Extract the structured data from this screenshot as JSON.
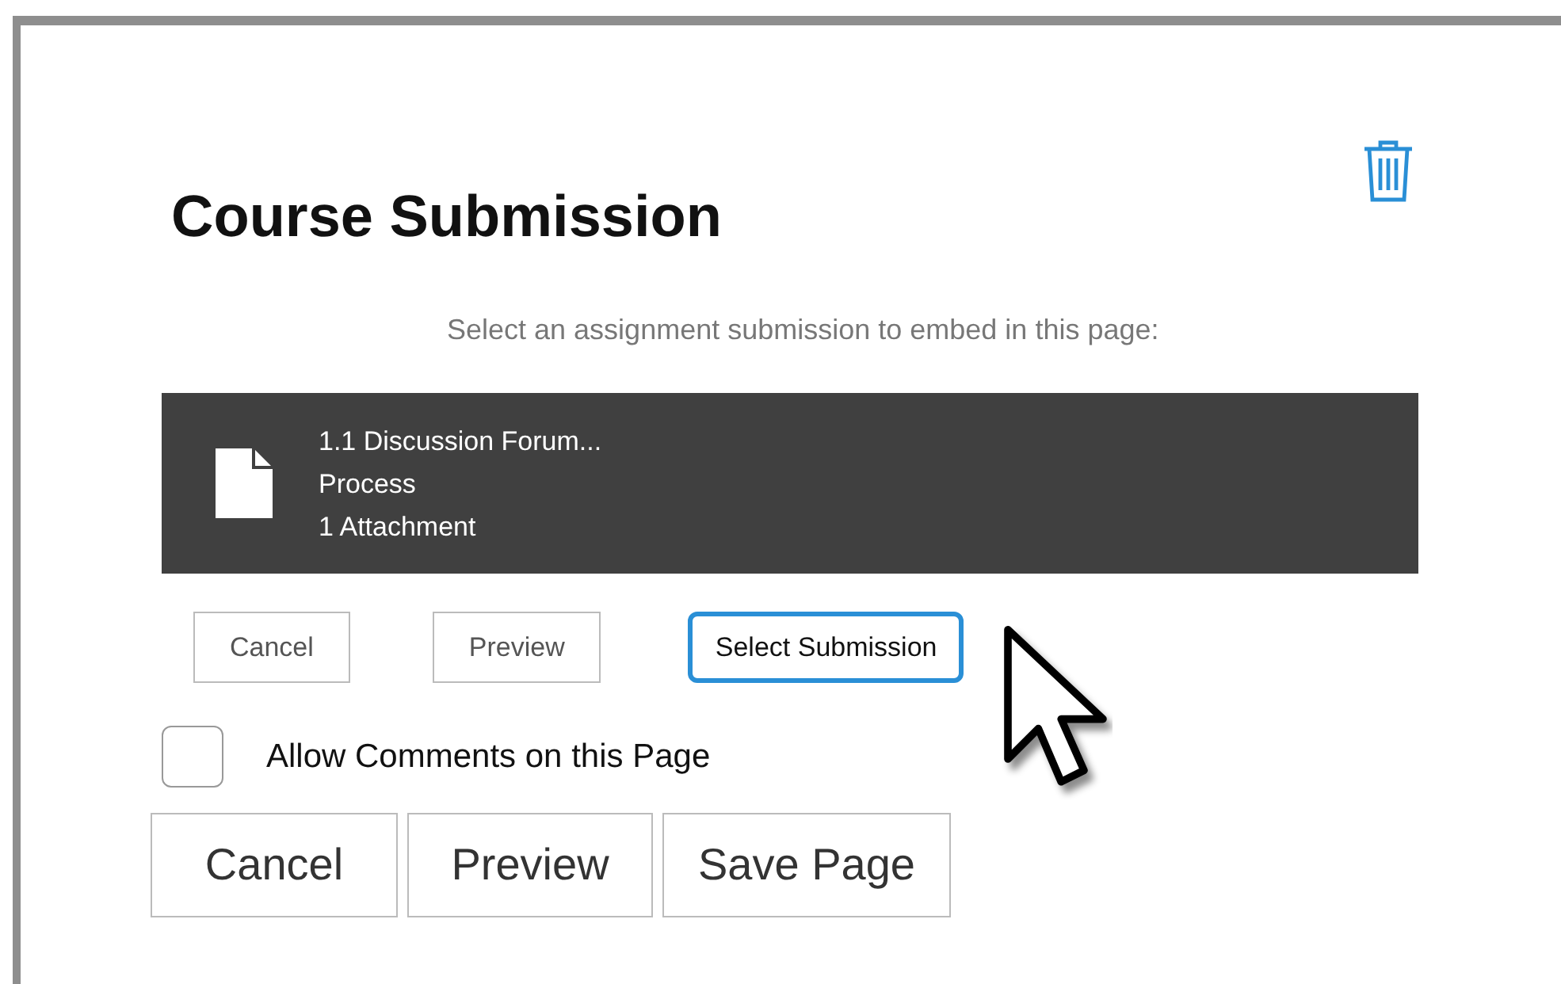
{
  "title": "Course Submission",
  "instruction": "Select an assignment submission to embed in this page:",
  "submission": {
    "lines": [
      "1.1 Discussion Forum...",
      "Process",
      "1 Attachment"
    ]
  },
  "submission_buttons": [
    {
      "label": "Cancel",
      "focused": false
    },
    {
      "label": "Preview",
      "focused": false
    },
    {
      "label": "Select Submission",
      "focused": true
    }
  ],
  "allow_comments": {
    "label": "Allow Comments on this Page",
    "checked": false
  },
  "page_buttons": [
    "Cancel",
    "Preview",
    "Save Page"
  ]
}
